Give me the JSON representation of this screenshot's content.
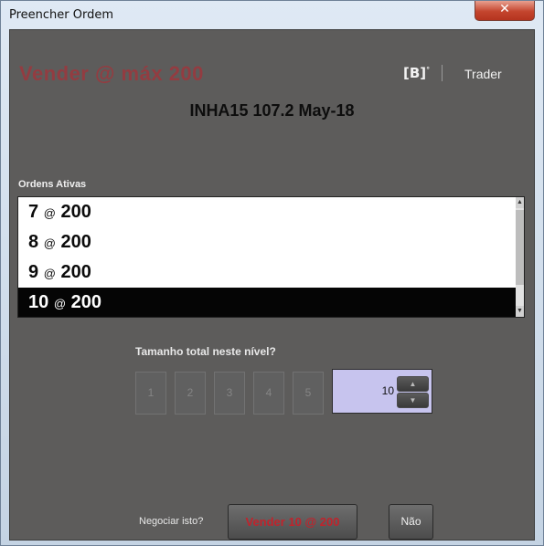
{
  "window": {
    "title": "Preencher Ordem",
    "close_glyph": "✕"
  },
  "header": {
    "title": "Vender @ máx 200",
    "brand": "[B]",
    "brand_sup": "°",
    "trader": "Trader",
    "instrument": "INHA15 107.2 May-18"
  },
  "orders": {
    "label": "Ordens Ativas",
    "rows": [
      {
        "qty": "7",
        "at": "@",
        "price": "200",
        "selected": false
      },
      {
        "qty": "8",
        "at": "@",
        "price": "200",
        "selected": false
      },
      {
        "qty": "9",
        "at": "@",
        "price": "200",
        "selected": false
      },
      {
        "qty": "10",
        "at": "@",
        "price": "200",
        "selected": true
      }
    ]
  },
  "size": {
    "prompt": "Tamanho total neste nível?",
    "options": [
      "1",
      "2",
      "3",
      "4",
      "5"
    ],
    "value": "10",
    "up_glyph": "▲",
    "down_glyph": "▼"
  },
  "footer": {
    "confirm_label": "Negociar isto?",
    "sell_label": "Vender 10 @ 200",
    "no_label": "Não"
  },
  "colors": {
    "panel_bg": "#5d5c5b",
    "sell_red": "#c0232c",
    "selected_row": "#050505",
    "qty_box": "#c7c4ee"
  }
}
